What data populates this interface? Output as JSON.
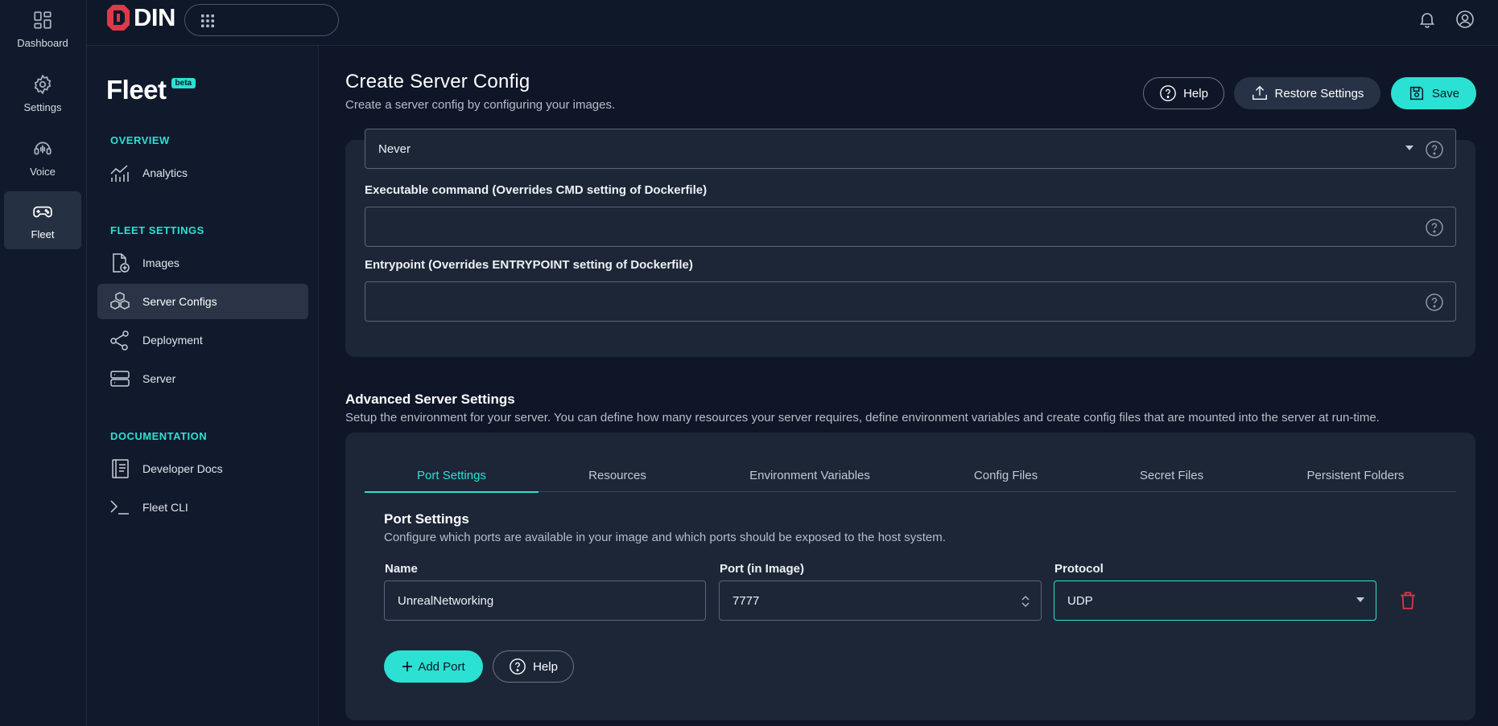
{
  "rail": {
    "items": [
      {
        "label": "Dashboard",
        "icon": "dashboard-icon"
      },
      {
        "label": "Settings",
        "icon": "gear-icon"
      },
      {
        "label": "Voice",
        "icon": "voice-icon"
      },
      {
        "label": "Fleet",
        "icon": "gamepad-icon"
      }
    ]
  },
  "topbar": {
    "logo_text": "DIN",
    "search_placeholder": ""
  },
  "sidebar": {
    "brand": "Fleet",
    "badge": "beta",
    "sections": {
      "overview": "OVERVIEW",
      "fleet_settings": "FLEET SETTINGS",
      "documentation": "DOCUMENTATION"
    },
    "items": {
      "analytics": "Analytics",
      "images": "Images",
      "server_configs": "Server Configs",
      "deployment": "Deployment",
      "server": "Server",
      "developer_docs": "Developer Docs",
      "fleet_cli": "Fleet CLI"
    }
  },
  "header": {
    "title": "Create Server Config",
    "subtitle": "Create a server config by configuring your images.",
    "help_label": "Help",
    "restore_label": "Restore Settings",
    "save_label": "Save"
  },
  "image_card": {
    "restart_value": "Never",
    "cmd_label": "Executable command (Overrides CMD setting of Dockerfile)",
    "cmd_value": "",
    "entrypoint_label": "Entrypoint (Overrides ENTRYPOINT setting of Dockerfile)",
    "entrypoint_value": ""
  },
  "advanced": {
    "title": "Advanced Server Settings",
    "subtitle": "Setup the environment for your server. You can define how many resources your server requires, define environment variables and create config files that are mounted into the server at run-time.",
    "tabs": [
      "Port Settings",
      "Resources",
      "Environment Variables",
      "Config Files",
      "Secret Files",
      "Persistent Folders"
    ],
    "active_tab": "Port Settings"
  },
  "port_settings": {
    "title": "Port Settings",
    "subtitle": "Configure which ports are available in your image and which ports should be exposed to the host system.",
    "name_label": "Name",
    "port_label": "Port (in Image)",
    "protocol_label": "Protocol",
    "rows": [
      {
        "name": "UnrealNetworking",
        "port": "7777",
        "protocol": "UDP"
      }
    ],
    "add_port_label": "Add Port",
    "help_label": "Help"
  },
  "colors": {
    "accent": "#2be1d3",
    "background": "#0e1627",
    "card": "#1c2637",
    "danger": "#e0384b"
  }
}
